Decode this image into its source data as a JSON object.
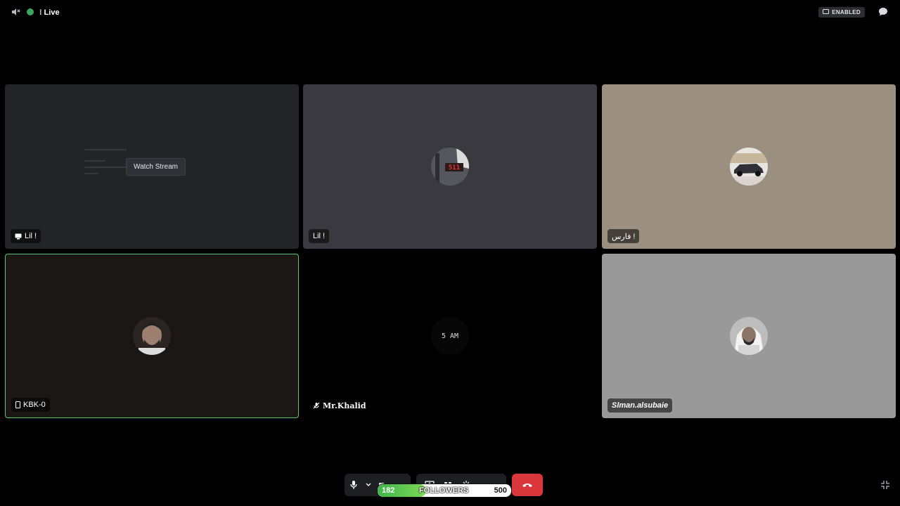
{
  "topbar": {
    "channel_name": "⁝ Live",
    "enabled_label": "ENABLED"
  },
  "tiles": [
    {
      "name": "Lil !",
      "has_stream": true,
      "stream_button": "Watch Stream",
      "tag_icon": "screen-share-icon"
    },
    {
      "name": "Lil !",
      "avatar_text": "511"
    },
    {
      "name": "فارس !"
    },
    {
      "name": "KBK-0",
      "tag_icon": "mobile-icon",
      "speaking": true
    },
    {
      "name": "Mr.Khalid",
      "tag_icon": "muted-mic-icon",
      "avatar_text": "5 AM"
    },
    {
      "name": "Slman.alsubaie"
    }
  ],
  "followers": {
    "current": "182",
    "label": "FOLLOWERS",
    "goal": "500",
    "progress": 0.364
  },
  "colors": {
    "accent_green": "#3ba55d",
    "hangup_red": "#da373c",
    "speaking_border": "#57c472"
  }
}
